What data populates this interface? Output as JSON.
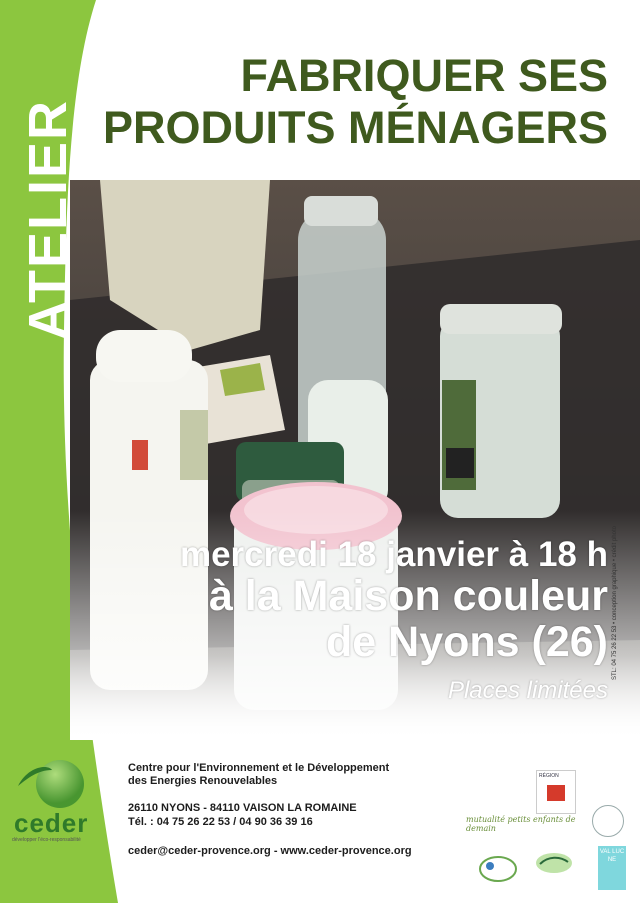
{
  "title": {
    "line1": "FABRIQUER SES",
    "line2": "PRODUITS MÉNAGERS"
  },
  "side_label": "ATELIER",
  "event": {
    "date": "mercredi 18 janvier à 18 h",
    "place_line1": "à la Maison couleur",
    "place_line2": "de Nyons (26)",
    "note": "Places limitées"
  },
  "photo_credit": "STL: 04 75 26 22 53 • conception graphique • crédit photo",
  "organization": {
    "logo_name": "ceder",
    "logo_tagline": "développer l'éco-responsabilité",
    "name_line1": "Centre pour l'Environnement et le Développement",
    "name_line2": "des Energies Renouvelables",
    "address": "26110 NYONS - 84110 VAISON LA ROMAINE",
    "phone": "Tél. : 04 75 26 22 53 / 04 90 36 39 16",
    "contact": "ceder@ceder-provence.org - www.ceder-provence.org"
  },
  "partners": {
    "p1_label": "RÉGION",
    "p2_label": "mutualité petits enfants de demain",
    "p6_label": "VAL LUC NE"
  },
  "colors": {
    "accent_green": "#8cc63f",
    "title_green": "#3f5a1e",
    "white": "#ffffff"
  }
}
